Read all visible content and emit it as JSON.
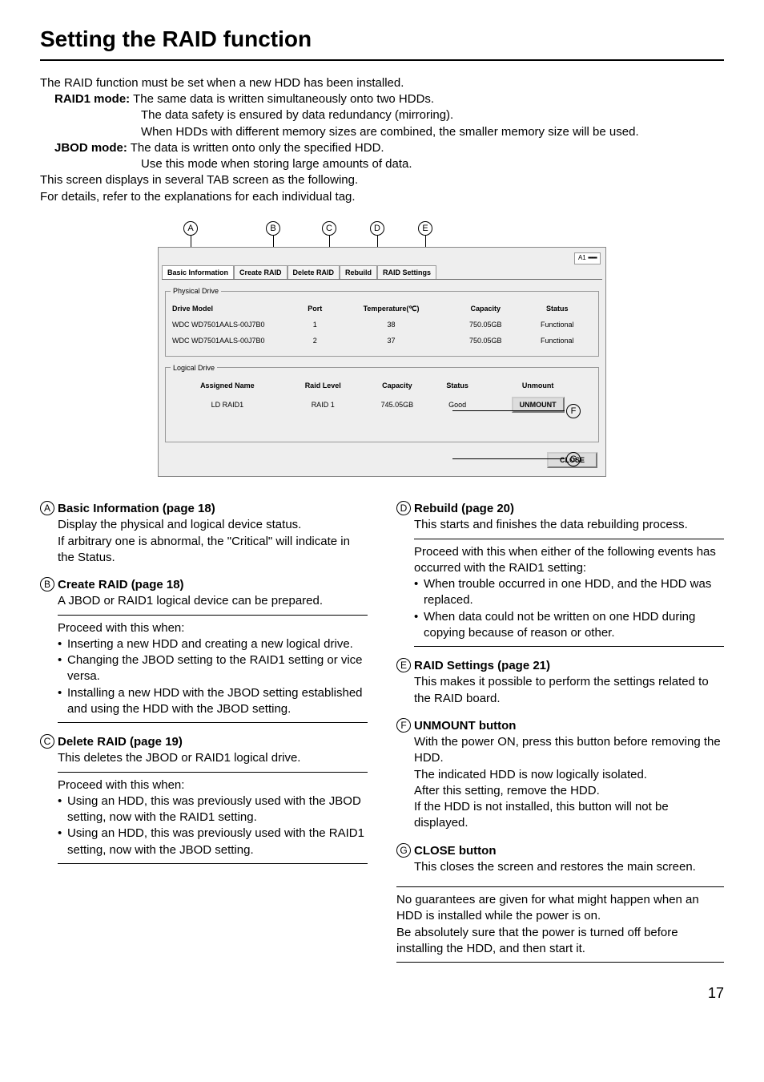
{
  "page_title": "Setting the RAID function",
  "page_number": "17",
  "intro": {
    "line1": "The RAID function must be set when a new HDD has been installed.",
    "raid1_label": "RAID1 mode:",
    "raid1_a": "The same data is written simultaneously onto two HDDs.",
    "raid1_b": "The data safety is ensured by data redundancy (mirroring).",
    "raid1_c": "When HDDs with different memory sizes are combined, the smaller memory size will be used.",
    "jbod_label": "JBOD mode:",
    "jbod_a": "The data is written onto only the specified HDD.",
    "jbod_b": "Use this mode when storing large amounts of data.",
    "line2": "This screen displays in several TAB screen as the following.",
    "line3": "For details, refer to the explanations for each individual tag."
  },
  "screenshot": {
    "version": "A1",
    "tabs": [
      "Basic Information",
      "Create RAID",
      "Delete RAID",
      "Rebuild",
      "RAID Settings"
    ],
    "physical_drive": {
      "legend": "Physical Drive",
      "headers": [
        "Drive Model",
        "Port",
        "Temperature(℃)",
        "Capacity",
        "Status"
      ],
      "rows": [
        [
          "WDC WD7501AALS-00J7B0",
          "1",
          "38",
          "750.05GB",
          "Functional"
        ],
        [
          "WDC WD7501AALS-00J7B0",
          "2",
          "37",
          "750.05GB",
          "Functional"
        ]
      ]
    },
    "logical_drive": {
      "legend": "Logical Drive",
      "headers": [
        "Assigned Name",
        "Raid Level",
        "Capacity",
        "Status",
        "Unmount"
      ],
      "rows": [
        [
          "LD RAID1",
          "RAID 1",
          "745.05GB",
          "Good",
          "UNMOUNT"
        ]
      ]
    },
    "close_label": "CLOSE"
  },
  "callouts_top": [
    "A",
    "B",
    "C",
    "D",
    "E"
  ],
  "callouts_side": {
    "F": "F",
    "G": "G"
  },
  "items": {
    "A": {
      "title": "Basic Information (page 18)",
      "body": [
        "Display the physical and logical device status.",
        "If arbitrary one is abnormal, the \"Critical\" will indicate in the Status."
      ]
    },
    "B": {
      "title": "Create RAID (page 18)",
      "body": [
        "A JBOD or RAID1 logical device can be prepared."
      ],
      "proceed": "Proceed with this when:",
      "bullets": [
        "Inserting a new HDD and creating a new logical drive.",
        "Changing the JBOD setting to the RAID1 setting or vice versa.",
        "Installing a new HDD with the JBOD setting established and using the HDD with the JBOD setting."
      ]
    },
    "C": {
      "title": "Delete RAID (page 19)",
      "body": [
        "This deletes the JBOD or RAID1 logical drive."
      ],
      "proceed": "Proceed with this when:",
      "bullets": [
        "Using an HDD, this was previously used with the JBOD setting, now with the RAID1 setting.",
        "Using an HDD, this was previously used with the RAID1 setting, now with the JBOD setting."
      ]
    },
    "D": {
      "title": "Rebuild (page 20)",
      "body": [
        "This starts and finishes the data rebuilding process."
      ],
      "proceed": "Proceed with this when either of the following events has occurred with the RAID1 setting:",
      "bullets": [
        "When trouble occurred in one HDD, and the HDD was replaced.",
        "When data could not be written on one HDD during copying because of reason or other."
      ]
    },
    "E": {
      "title": "RAID Settings (page 21)",
      "body": [
        "This makes it possible to perform the settings related to the RAID board."
      ]
    },
    "F": {
      "title": "UNMOUNT button",
      "body": [
        "With the power ON, press this button before removing the HDD.",
        "The indicated HDD is now logically isolated.",
        "After this setting, remove the HDD.",
        "If the HDD is not installed, this button will not be displayed."
      ]
    },
    "G": {
      "title": "CLOSE button",
      "body": [
        "This closes the screen and restores the main screen."
      ]
    }
  },
  "note": [
    "No guarantees are given for what might happen when an HDD is installed while the power is on.",
    "Be absolutely sure that the power is turned off before installing the HDD, and then start it."
  ]
}
